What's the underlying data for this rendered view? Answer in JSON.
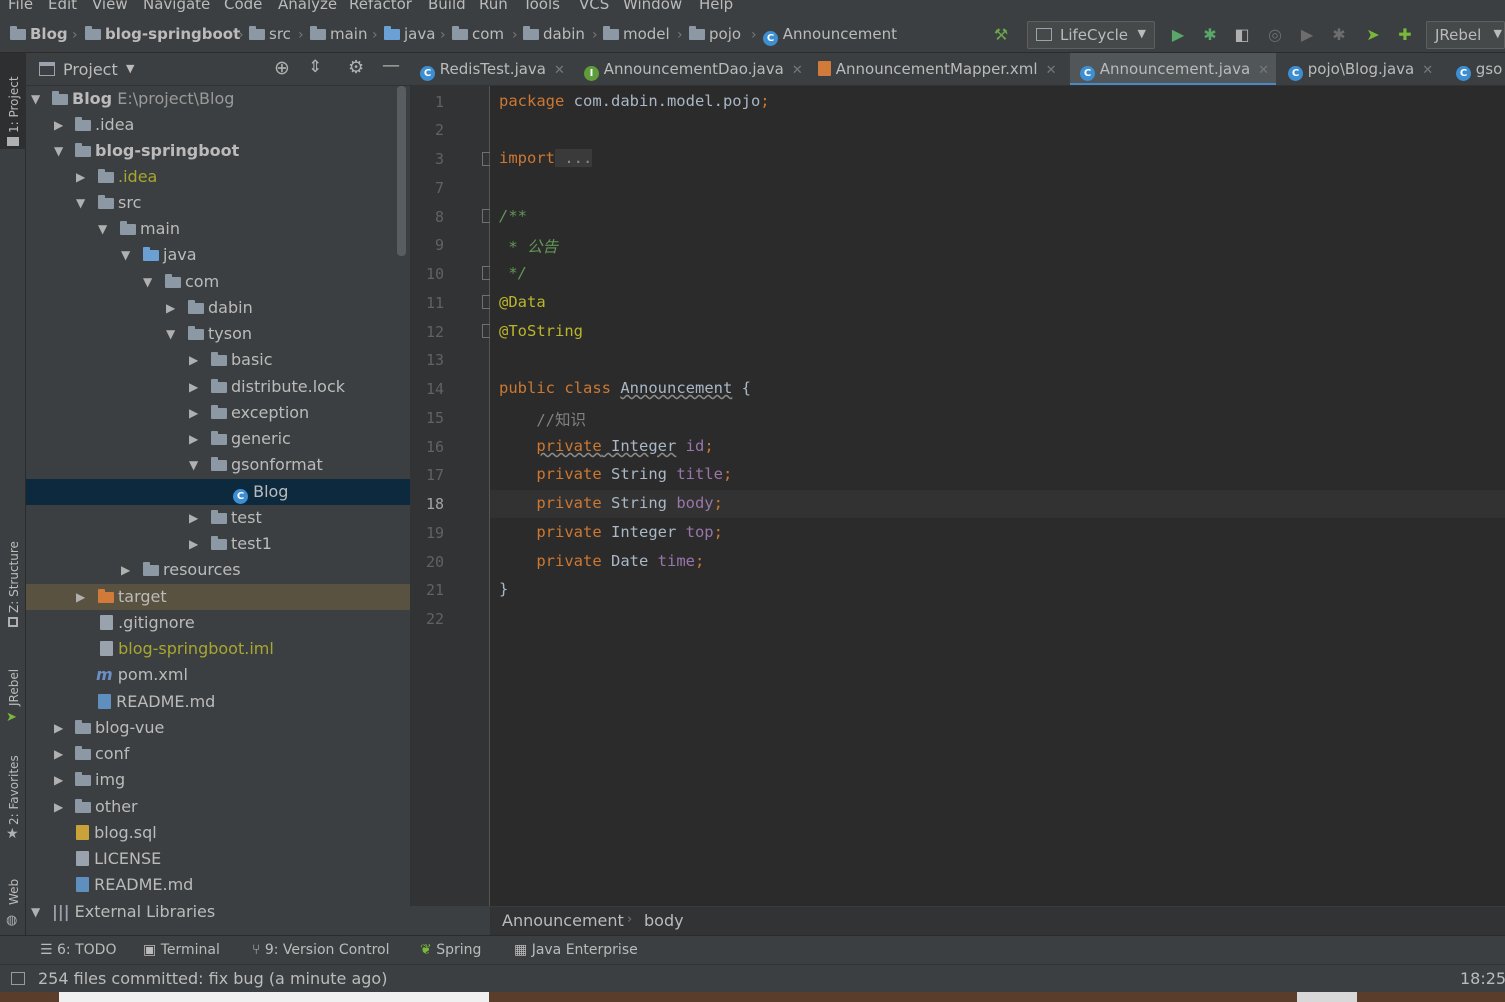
{
  "menu": [
    "File",
    "Edit",
    "View",
    "Navigate",
    "Code",
    "Analyze",
    "Refactor",
    "Build",
    "Run",
    "Tools",
    "VCS",
    "Window",
    "Help"
  ],
  "breadcrumb": [
    "Blog",
    "blog-springboot",
    "src",
    "main",
    "java",
    "com",
    "dabin",
    "model",
    "pojo",
    "Announcement"
  ],
  "toolbar": {
    "run_config": "LifeCycle",
    "jrebel": "JRebel"
  },
  "left_tools": {
    "project": "1: Project",
    "structure": "Z: Structure",
    "jrebel": "JRebel",
    "favorites": "2: Favorites",
    "web": "Web"
  },
  "project_panel": {
    "title": "Project"
  },
  "tree": [
    {
      "label": "Blog",
      "path": "E:\\project\\Blog",
      "depth": 0,
      "expanded": true
    },
    {
      "label": ".idea",
      "depth": 1
    },
    {
      "label": "blog-springboot",
      "depth": 1,
      "expanded": true
    },
    {
      "label": ".idea",
      "depth": 2
    },
    {
      "label": "src",
      "depth": 2,
      "expanded": true
    },
    {
      "label": "main",
      "depth": 3,
      "expanded": true
    },
    {
      "label": "java",
      "depth": 4,
      "expanded": true
    },
    {
      "label": "com",
      "depth": 5,
      "expanded": true
    },
    {
      "label": "dabin",
      "depth": 6
    },
    {
      "label": "tyson",
      "depth": 6,
      "expanded": true
    },
    {
      "label": "basic",
      "depth": 7
    },
    {
      "label": "distribute.lock",
      "depth": 7
    },
    {
      "label": "exception",
      "depth": 7
    },
    {
      "label": "generic",
      "depth": 7
    },
    {
      "label": "gsonformat",
      "depth": 7,
      "expanded": true
    },
    {
      "label": "Blog",
      "depth": 8,
      "selected": true
    },
    {
      "label": "test",
      "depth": 7
    },
    {
      "label": "test1",
      "depth": 7
    },
    {
      "label": "resources",
      "depth": 4
    },
    {
      "label": "target",
      "depth": 2
    },
    {
      "label": ".gitignore",
      "depth": 2
    },
    {
      "label": "blog-springboot.iml",
      "depth": 2
    },
    {
      "label": "pom.xml",
      "depth": 2
    },
    {
      "label": "README.md",
      "depth": 2
    },
    {
      "label": "blog-vue",
      "depth": 1
    },
    {
      "label": "conf",
      "depth": 1
    },
    {
      "label": "img",
      "depth": 1
    },
    {
      "label": "other",
      "depth": 1
    },
    {
      "label": "blog.sql",
      "depth": 1
    },
    {
      "label": "LICENSE",
      "depth": 1
    },
    {
      "label": "README.md",
      "depth": 1
    },
    {
      "label": "External Libraries",
      "depth": 0,
      "expanded": true
    }
  ],
  "tabs": [
    {
      "label": "RedisTest.java",
      "icon": "class-icon"
    },
    {
      "label": "AnnouncementDao.java",
      "icon": "interface-icon"
    },
    {
      "label": "AnnouncementMapper.xml",
      "icon": "xml-icon"
    },
    {
      "label": "Announcement.java",
      "icon": "class-icon",
      "active": true
    },
    {
      "label": "pojo\\Blog.java",
      "icon": "class-icon"
    },
    {
      "label": "gso",
      "icon": "class-icon"
    }
  ],
  "line_numbers": [
    "1",
    "2",
    "3",
    "7",
    "8",
    "9",
    "10",
    "11",
    "12",
    "13",
    "14",
    "15",
    "16",
    "17",
    "18",
    "19",
    "20",
    "21",
    "22"
  ],
  "current_line": "18",
  "code": {
    "l1_kw": "package",
    "l1_rest": " com.dabin.model.pojo",
    "l1_semi": ";",
    "l3_kw": "import",
    "l3_rest": " ...",
    "l8": "/**",
    "l9": " * 公告",
    "l10": " */",
    "l11": "@Data",
    "l12": "@ToString",
    "l14_kw": "public class ",
    "l14_name": "Announcement",
    "l14_rest": " {",
    "l15": "    //知识",
    "l16_kw": "private",
    "l16_type": " Integer",
    "l16_field": " id",
    "l16_semi": ";",
    "l17_kw": "private",
    "l17_type": " String",
    "l17_field": " title",
    "l17_semi": ";",
    "l18_kw": "private",
    "l18_type": " String",
    "l18_field": " body",
    "l18_semi": ";",
    "l19_kw": "private",
    "l19_type": " Integer",
    "l19_field": " top",
    "l19_semi": ";",
    "l20_kw": "private",
    "l20_type": " Date",
    "l20_field": " time",
    "l20_semi": ";",
    "l21": "}"
  },
  "editor_breadcrumb": [
    "Announcement",
    "body"
  ],
  "bottom_tools": [
    {
      "label": "6: TODO",
      "icon": "list-icon"
    },
    {
      "label": "Terminal",
      "icon": "terminal-icon"
    },
    {
      "label": "9: Version Control",
      "icon": "vcs-icon"
    },
    {
      "label": "Spring",
      "icon": "spring-icon"
    },
    {
      "label": "Java Enterprise",
      "icon": "java-enterprise-icon"
    }
  ],
  "status": {
    "message": "254 files committed: fix bug (a minute ago)",
    "time": "18:25"
  }
}
